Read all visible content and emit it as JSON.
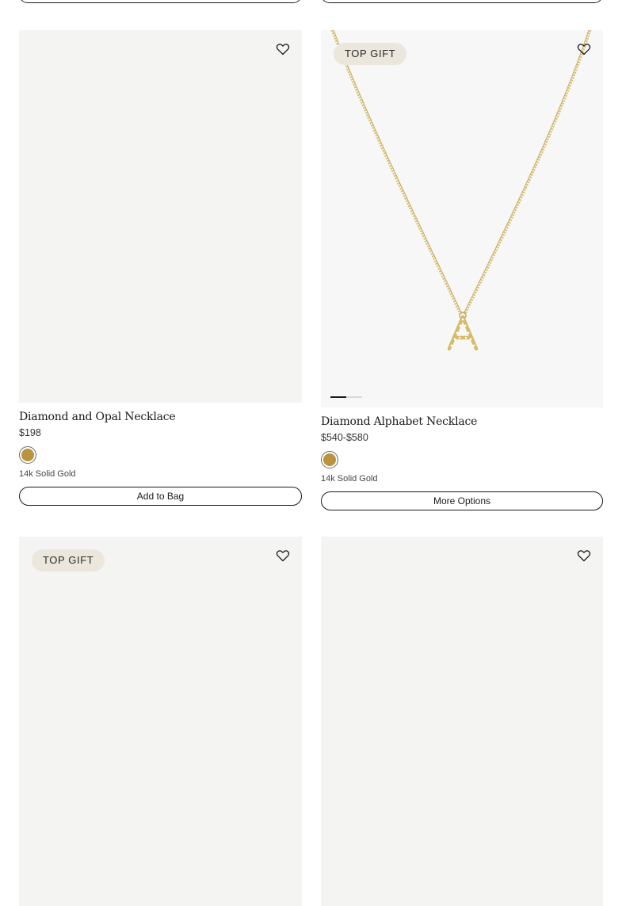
{
  "products": [
    {
      "title": "",
      "price": "",
      "badge": "",
      "material": "",
      "action": ""
    },
    {
      "title": "Diamond and Opal Necklace",
      "price": "$198",
      "material": "14k Solid Gold",
      "action": "Add to Bag",
      "swatch_color": "#b8953c",
      "wishlist_icon": "heart-icon"
    },
    {
      "title": "Diamond Alphabet Necklace",
      "price": "$540-$580",
      "badge": "TOP GIFT",
      "material": "14k Solid Gold",
      "action": "More Options",
      "swatch_color": "#b8953c",
      "wishlist_icon": "heart-icon",
      "image_slide": 1,
      "image_slides_total": 2
    },
    {
      "badge": "TOP GIFT",
      "wishlist_icon": "heart-icon"
    },
    {
      "wishlist_icon": "heart-icon"
    }
  ],
  "colors": {
    "badge_bg": "#ebe7dd",
    "media_bg": "#f4f4f2",
    "gold": "#b8953c"
  }
}
